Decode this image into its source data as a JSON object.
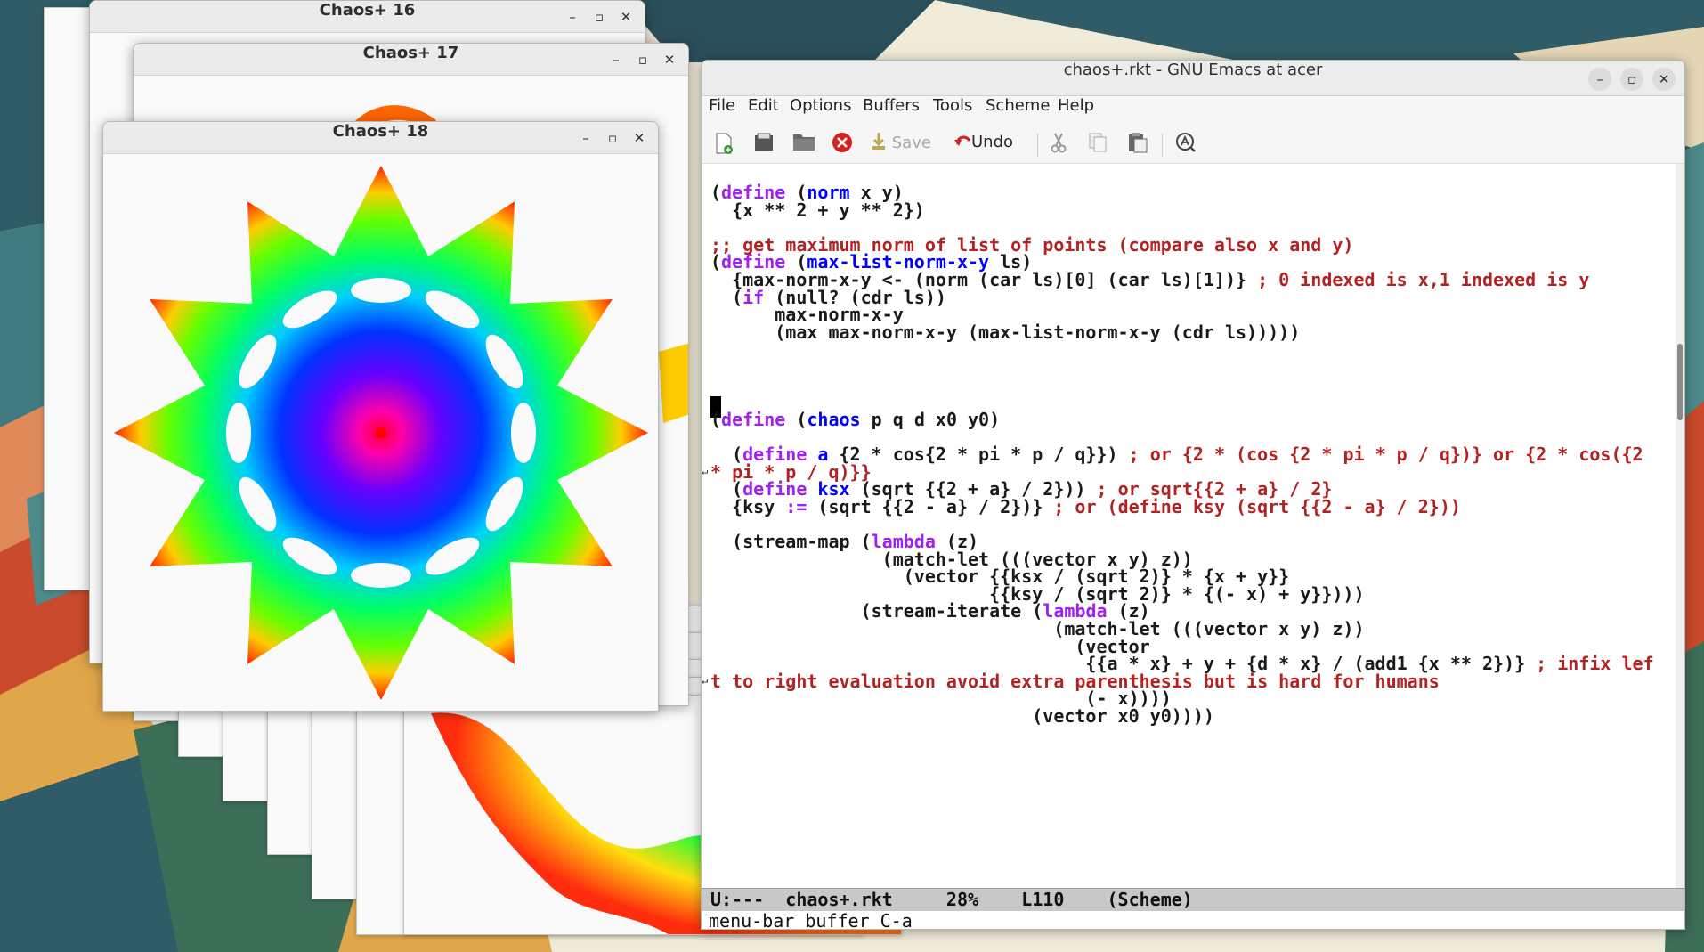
{
  "windows": {
    "chaos16": {
      "title": "Chaos+ 16"
    },
    "chaos17": {
      "title": "Chaos+ 17"
    },
    "chaos18": {
      "title": "Chaos+ 18"
    }
  },
  "emacs": {
    "title": "chaos+.rkt - GNU Emacs at acer",
    "menu": [
      "File",
      "Edit",
      "Options",
      "Buffers",
      "Tools",
      "Scheme",
      "Help"
    ],
    "toolbar": {
      "save": "Save",
      "undo": "Undo"
    },
    "code": [
      [
        [
          "p",
          "("
        ],
        [
          "kw",
          "define"
        ],
        [
          "p",
          " ("
        ],
        [
          "fn",
          "norm"
        ],
        [
          "p",
          " x y)"
        ]
      ],
      [
        [
          "p",
          "  {x ** 2 + y ** 2})"
        ]
      ],
      [],
      [
        [
          "cm",
          ";; get maximum norm of list of points (compare also x and y)"
        ]
      ],
      [
        [
          "p",
          "("
        ],
        [
          "kw",
          "define"
        ],
        [
          "p",
          " ("
        ],
        [
          "fn",
          "max-list-norm-x-y"
        ],
        [
          "p",
          " ls)"
        ]
      ],
      [
        [
          "p",
          "  {max-norm-x-y <- (norm (car ls)[0] (car ls)[1])} "
        ],
        [
          "cm",
          "; 0 indexed is x,1 indexed is y"
        ]
      ],
      [
        [
          "p",
          "  ("
        ],
        [
          "kw",
          "if"
        ],
        [
          "p",
          " (null? (cdr ls))"
        ]
      ],
      [
        [
          "p",
          "      max-norm-x-y"
        ]
      ],
      [
        [
          "p",
          "      (max max-norm-x-y (max-list-norm-x-y (cdr ls)))))"
        ]
      ],
      [],
      [],
      [],
      [],
      [
        [
          "p",
          "("
        ],
        [
          "kw",
          "define"
        ],
        [
          "p",
          " ("
        ],
        [
          "fn",
          "chaos"
        ],
        [
          "p",
          " p q d x0 y0)"
        ]
      ],
      [],
      [
        [
          "p",
          "  ("
        ],
        [
          "kw",
          "define"
        ],
        [
          "p",
          " "
        ],
        [
          "fn",
          "a"
        ],
        [
          "p",
          " {2 * cos{2 * pi * p / q}}) "
        ],
        [
          "cm",
          "; or {2 * (cos {2 * pi * p / q})} or {2 * cos({2 "
        ]
      ],
      [
        [
          "cm",
          "* pi * p / q)}}"
        ]
      ],
      [
        [
          "p",
          "  ("
        ],
        [
          "kw",
          "define"
        ],
        [
          "p",
          " "
        ],
        [
          "fn",
          "ksx"
        ],
        [
          "p",
          " (sqrt {{2 + a} / 2})) "
        ],
        [
          "cm",
          "; or sqrt{{2 + a} / 2}"
        ]
      ],
      [
        [
          "p",
          "  {ksy "
        ],
        [
          "kw",
          ":="
        ],
        [
          "p",
          " (sqrt {{2 - a} / 2})} "
        ],
        [
          "cm",
          "; or (define ksy (sqrt {{2 - a} / 2}))"
        ]
      ],
      [],
      [
        [
          "p",
          "  (stream-map ("
        ],
        [
          "kw",
          "lambda"
        ],
        [
          "p",
          " (z)"
        ]
      ],
      [
        [
          "p",
          "                (match-let (((vector x y) z))"
        ]
      ],
      [
        [
          "p",
          "                  (vector {{ksx / (sqrt 2)} * {x + y}}"
        ]
      ],
      [
        [
          "p",
          "                          {{ksy / (sqrt 2)} * {(- x) + y}})))"
        ]
      ],
      [
        [
          "p",
          "              (stream-iterate ("
        ],
        [
          "kw",
          "lambda"
        ],
        [
          "p",
          " (z)"
        ]
      ],
      [
        [
          "p",
          "                                (match-let (((vector x y) z))"
        ]
      ],
      [
        [
          "p",
          "                                  (vector"
        ]
      ],
      [
        [
          "p",
          "                                   {{a * x} + y + {d * x} / (add1 {x ** 2})} "
        ],
        [
          "cm",
          "; infix lef"
        ]
      ],
      [
        [
          "cm",
          "t to right evaluation avoid extra parenthesis but is hard for humans"
        ]
      ],
      [
        [
          "p",
          "                                   (- x))))"
        ]
      ],
      [
        [
          "p",
          "                              (vector x0 y0))))"
        ]
      ]
    ],
    "modeline": "U:---  chaos+.rkt     28%    L110    (Scheme)",
    "echo": "menu-bar buffer C-a"
  }
}
